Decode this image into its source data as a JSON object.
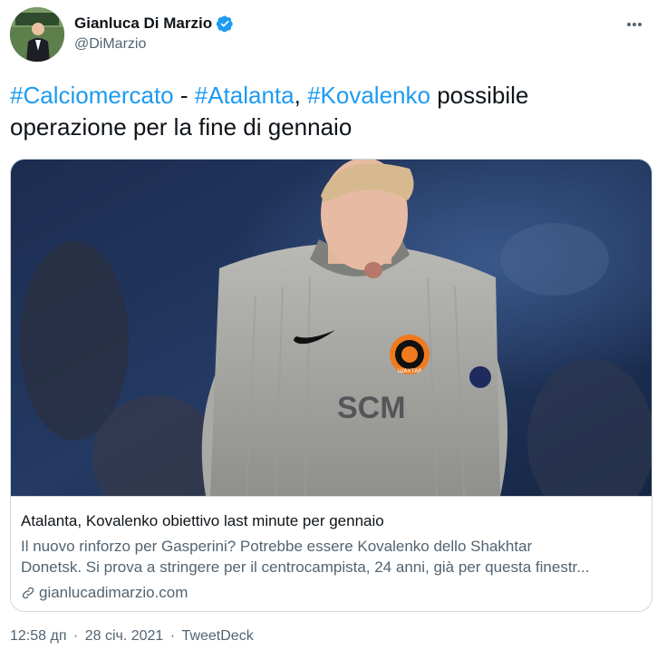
{
  "tweet": {
    "author": {
      "display_name": "Gianluca Di Marzio",
      "handle": "@DiMarzio",
      "verified": true
    },
    "text": {
      "hashtag1": "#Calciomercato",
      "sep1": " - ",
      "hashtag2": "#Atalanta",
      "sep2": ", ",
      "hashtag3": "#Kovalenko",
      "rest": " possibile operazione per la fine di gennaio"
    },
    "card": {
      "jersey_text": "SCM",
      "badge_text": "ШАХТАР",
      "title": "Atalanta, Kovalenko obiettivo last minute per gennaio",
      "description_line1": "Il nuovo rinforzo per Gasperini? Potrebbe essere Kovalenko dello Shakhtar",
      "description_line2": "Donetsk. Si prova a stringere per il centrocampista, 24 anni, già per questa finestr...",
      "domain": "gianlucadimarzio.com"
    },
    "meta": {
      "time": "12:58 дп",
      "dot1": " · ",
      "date": "28 січ. 2021",
      "dot2": " · ",
      "source": "TweetDeck"
    }
  },
  "colors": {
    "accent": "#1d9bf0",
    "text": "#0f1419",
    "muted": "#536471",
    "border": "#cfd9de"
  },
  "icons": {
    "verified": "verified-badge-icon",
    "more": "more-dots-icon",
    "link": "link-icon"
  }
}
